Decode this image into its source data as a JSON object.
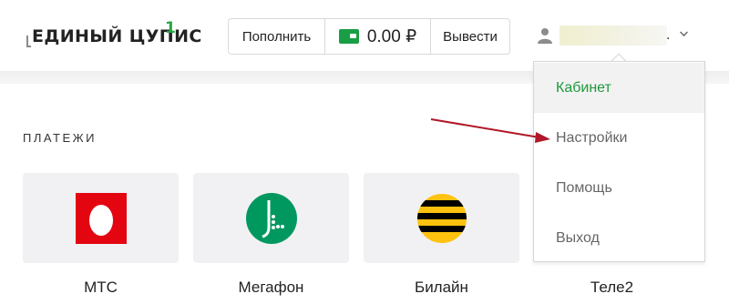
{
  "logo": {
    "text": "ЕДИНЫЙ ЦУПИС",
    "superscript": "1",
    "accent_color": "#25a645"
  },
  "wallet": {
    "topup_label": "Пополнить",
    "balance": "0.00 ₽",
    "withdraw_label": "Вывести",
    "icon": "wallet-icon"
  },
  "user": {
    "name_suffix": ".",
    "icon": "user-icon",
    "menu_icon": "chevron-down-icon"
  },
  "dropdown": {
    "items": [
      {
        "label": "Кабинет",
        "active": true
      },
      {
        "label": "Настройки",
        "active": false
      },
      {
        "label": "Помощь",
        "active": false
      },
      {
        "label": "Выход",
        "active": false
      }
    ]
  },
  "payments": {
    "title": "ПЛАТЕЖИ",
    "cards": [
      {
        "label": "МТС",
        "icon": "mts-logo"
      },
      {
        "label": "Мегафон",
        "icon": "megafon-logo"
      },
      {
        "label": "Билайн",
        "icon": "beeline-logo"
      },
      {
        "label": "Теле2",
        "icon": "tele2-logo"
      }
    ]
  },
  "colors": {
    "brand_green": "#1e9a3b",
    "annotation_arrow": "#b0182a"
  }
}
